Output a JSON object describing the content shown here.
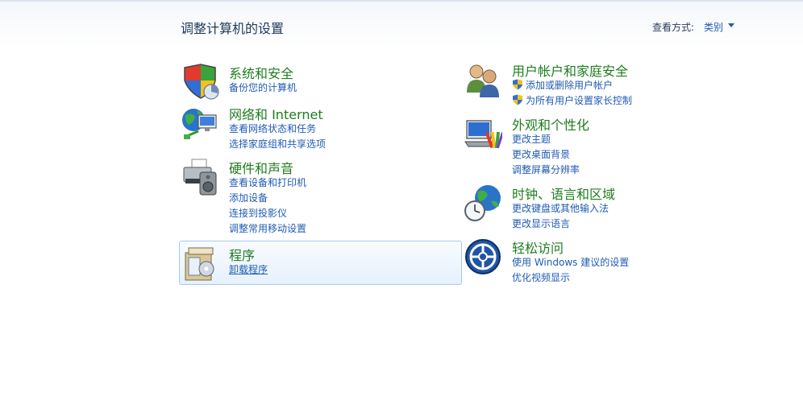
{
  "header": {
    "title": "调整计算机的设置",
    "view_by_label": "查看方式:",
    "view_by_value": "类别"
  },
  "categories": {
    "system_security": {
      "title": "系统和安全",
      "links": [
        "备份您的计算机"
      ],
      "icon": "shield-icon"
    },
    "network_internet": {
      "title": "网络和 Internet",
      "links": [
        "查看网络状态和任务",
        "选择家庭组和共享选项"
      ],
      "icon": "network-globe-icon"
    },
    "hardware_sound": {
      "title": "硬件和声音",
      "links": [
        "查看设备和打印机",
        "添加设备",
        "连接到投影仪",
        "调整常用移动设置"
      ],
      "icon": "printer-icon"
    },
    "programs": {
      "title": "程序",
      "links": [
        "卸载程序"
      ],
      "icon": "programs-box-icon"
    },
    "user_accounts": {
      "title": "用户帐户和家庭安全",
      "links": [
        "添加或删除用户帐户",
        "为所有用户设置家长控制"
      ],
      "icon": "users-icon"
    },
    "appearance": {
      "title": "外观和个性化",
      "links": [
        "更改主题",
        "更改桌面背景",
        "调整屏幕分辨率"
      ],
      "icon": "monitor-palette-icon"
    },
    "clock_region": {
      "title": "时钟、语言和区域",
      "links": [
        "更改键盘或其他输入法",
        "更改显示语言"
      ],
      "icon": "globe-clock-icon"
    },
    "ease_access": {
      "title": "轻松访问",
      "links": [
        "使用 Windows 建议的设置",
        "优化视频显示"
      ],
      "icon": "ease-of-access-icon"
    }
  }
}
